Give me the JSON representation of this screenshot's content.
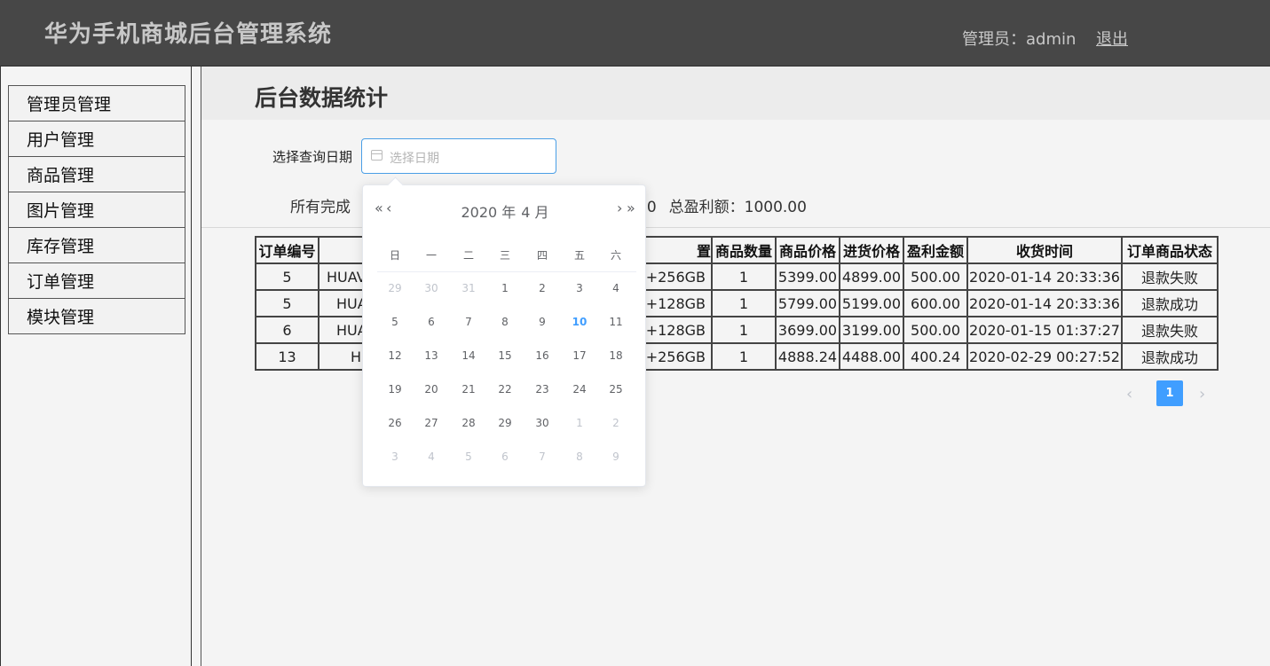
{
  "header": {
    "app_title": "华为手机商城后台管理系统",
    "admin_label": "管理员：admin",
    "logout": "退出"
  },
  "sidebar": {
    "items": [
      {
        "label": "管理员管理"
      },
      {
        "label": "用户管理"
      },
      {
        "label": "商品管理"
      },
      {
        "label": "图片管理"
      },
      {
        "label": "库存管理"
      },
      {
        "label": "订单管理"
      },
      {
        "label": "模块管理"
      }
    ]
  },
  "main": {
    "page_title": "后台数据统计",
    "date_label": "选择查询日期",
    "date_placeholder": "选择日期",
    "summary_left": "所有完成",
    "summary_mid": "00",
    "summary_right": "总盈利额：1000.00"
  },
  "table": {
    "headers": [
      "订单编号",
      "",
      "置",
      "商品数量",
      "商品价格",
      "进货价格",
      "盈利金额",
      "收货时间",
      "订单商品状态"
    ],
    "rows": [
      [
        "5",
        "HUAV",
        "+256GB",
        "1",
        "5399.00",
        "4899.00",
        "500.00",
        "2020-01-14 20:33:36",
        "退款失败"
      ],
      [
        "5",
        "HUA",
        "+128GB",
        "1",
        "5799.00",
        "5199.00",
        "600.00",
        "2020-01-14 20:33:36",
        "退款成功"
      ],
      [
        "6",
        "HUA",
        "+128GB",
        "1",
        "3699.00",
        "3199.00",
        "500.00",
        "2020-01-15 01:37:27",
        "退款失败"
      ],
      [
        "13",
        "H",
        "+256GB",
        "1",
        "4888.24",
        "4488.00",
        "400.24",
        "2020-02-29 00:27:52",
        "退款成功"
      ]
    ]
  },
  "pagination": {
    "prev": "‹",
    "current": "1",
    "next": "›"
  },
  "datepicker": {
    "prev_year": "«",
    "prev_month": "‹",
    "next_month": "›",
    "next_year": "»",
    "year": "2020 年",
    "month": "4 月",
    "weekdays": [
      "日",
      "一",
      "二",
      "三",
      "四",
      "五",
      "六"
    ],
    "weeks": [
      [
        {
          "d": "29",
          "s": "other"
        },
        {
          "d": "30",
          "s": "other"
        },
        {
          "d": "31",
          "s": "other"
        },
        {
          "d": "1",
          "s": ""
        },
        {
          "d": "2",
          "s": ""
        },
        {
          "d": "3",
          "s": ""
        },
        {
          "d": "4",
          "s": ""
        }
      ],
      [
        {
          "d": "5",
          "s": ""
        },
        {
          "d": "6",
          "s": ""
        },
        {
          "d": "7",
          "s": ""
        },
        {
          "d": "8",
          "s": ""
        },
        {
          "d": "9",
          "s": ""
        },
        {
          "d": "10",
          "s": "today"
        },
        {
          "d": "11",
          "s": ""
        }
      ],
      [
        {
          "d": "12",
          "s": ""
        },
        {
          "d": "13",
          "s": ""
        },
        {
          "d": "14",
          "s": ""
        },
        {
          "d": "15",
          "s": ""
        },
        {
          "d": "16",
          "s": ""
        },
        {
          "d": "17",
          "s": ""
        },
        {
          "d": "18",
          "s": ""
        }
      ],
      [
        {
          "d": "19",
          "s": ""
        },
        {
          "d": "20",
          "s": ""
        },
        {
          "d": "21",
          "s": ""
        },
        {
          "d": "22",
          "s": ""
        },
        {
          "d": "23",
          "s": ""
        },
        {
          "d": "24",
          "s": ""
        },
        {
          "d": "25",
          "s": ""
        }
      ],
      [
        {
          "d": "26",
          "s": ""
        },
        {
          "d": "27",
          "s": ""
        },
        {
          "d": "28",
          "s": ""
        },
        {
          "d": "29",
          "s": ""
        },
        {
          "d": "30",
          "s": ""
        },
        {
          "d": "1",
          "s": "other"
        },
        {
          "d": "2",
          "s": "other"
        }
      ],
      [
        {
          "d": "3",
          "s": "other"
        },
        {
          "d": "4",
          "s": "other"
        },
        {
          "d": "5",
          "s": "other"
        },
        {
          "d": "6",
          "s": "other"
        },
        {
          "d": "7",
          "s": "other"
        },
        {
          "d": "8",
          "s": "other"
        },
        {
          "d": "9",
          "s": "other"
        }
      ]
    ]
  },
  "colors": {
    "header_bg": "#474747",
    "accent": "#409eff"
  }
}
